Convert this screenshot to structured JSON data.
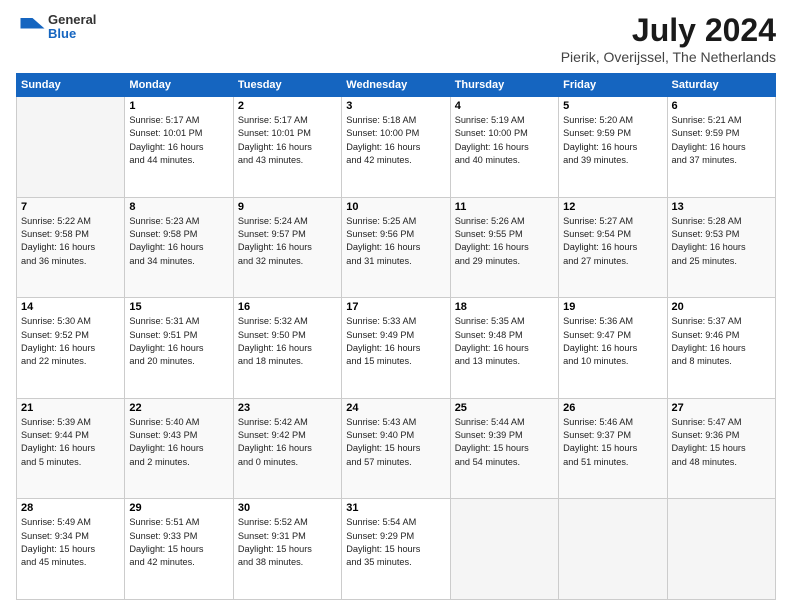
{
  "header": {
    "logo_general": "General",
    "logo_blue": "Blue",
    "month_year": "July 2024",
    "location": "Pierik, Overijssel, The Netherlands"
  },
  "weekdays": [
    "Sunday",
    "Monday",
    "Tuesday",
    "Wednesday",
    "Thursday",
    "Friday",
    "Saturday"
  ],
  "weeks": [
    [
      {
        "day": "",
        "info": ""
      },
      {
        "day": "1",
        "info": "Sunrise: 5:17 AM\nSunset: 10:01 PM\nDaylight: 16 hours\nand 44 minutes."
      },
      {
        "day": "2",
        "info": "Sunrise: 5:17 AM\nSunset: 10:01 PM\nDaylight: 16 hours\nand 43 minutes."
      },
      {
        "day": "3",
        "info": "Sunrise: 5:18 AM\nSunset: 10:00 PM\nDaylight: 16 hours\nand 42 minutes."
      },
      {
        "day": "4",
        "info": "Sunrise: 5:19 AM\nSunset: 10:00 PM\nDaylight: 16 hours\nand 40 minutes."
      },
      {
        "day": "5",
        "info": "Sunrise: 5:20 AM\nSunset: 9:59 PM\nDaylight: 16 hours\nand 39 minutes."
      },
      {
        "day": "6",
        "info": "Sunrise: 5:21 AM\nSunset: 9:59 PM\nDaylight: 16 hours\nand 37 minutes."
      }
    ],
    [
      {
        "day": "7",
        "info": "Sunrise: 5:22 AM\nSunset: 9:58 PM\nDaylight: 16 hours\nand 36 minutes."
      },
      {
        "day": "8",
        "info": "Sunrise: 5:23 AM\nSunset: 9:58 PM\nDaylight: 16 hours\nand 34 minutes."
      },
      {
        "day": "9",
        "info": "Sunrise: 5:24 AM\nSunset: 9:57 PM\nDaylight: 16 hours\nand 32 minutes."
      },
      {
        "day": "10",
        "info": "Sunrise: 5:25 AM\nSunset: 9:56 PM\nDaylight: 16 hours\nand 31 minutes."
      },
      {
        "day": "11",
        "info": "Sunrise: 5:26 AM\nSunset: 9:55 PM\nDaylight: 16 hours\nand 29 minutes."
      },
      {
        "day": "12",
        "info": "Sunrise: 5:27 AM\nSunset: 9:54 PM\nDaylight: 16 hours\nand 27 minutes."
      },
      {
        "day": "13",
        "info": "Sunrise: 5:28 AM\nSunset: 9:53 PM\nDaylight: 16 hours\nand 25 minutes."
      }
    ],
    [
      {
        "day": "14",
        "info": "Sunrise: 5:30 AM\nSunset: 9:52 PM\nDaylight: 16 hours\nand 22 minutes."
      },
      {
        "day": "15",
        "info": "Sunrise: 5:31 AM\nSunset: 9:51 PM\nDaylight: 16 hours\nand 20 minutes."
      },
      {
        "day": "16",
        "info": "Sunrise: 5:32 AM\nSunset: 9:50 PM\nDaylight: 16 hours\nand 18 minutes."
      },
      {
        "day": "17",
        "info": "Sunrise: 5:33 AM\nSunset: 9:49 PM\nDaylight: 16 hours\nand 15 minutes."
      },
      {
        "day": "18",
        "info": "Sunrise: 5:35 AM\nSunset: 9:48 PM\nDaylight: 16 hours\nand 13 minutes."
      },
      {
        "day": "19",
        "info": "Sunrise: 5:36 AM\nSunset: 9:47 PM\nDaylight: 16 hours\nand 10 minutes."
      },
      {
        "day": "20",
        "info": "Sunrise: 5:37 AM\nSunset: 9:46 PM\nDaylight: 16 hours\nand 8 minutes."
      }
    ],
    [
      {
        "day": "21",
        "info": "Sunrise: 5:39 AM\nSunset: 9:44 PM\nDaylight: 16 hours\nand 5 minutes."
      },
      {
        "day": "22",
        "info": "Sunrise: 5:40 AM\nSunset: 9:43 PM\nDaylight: 16 hours\nand 2 minutes."
      },
      {
        "day": "23",
        "info": "Sunrise: 5:42 AM\nSunset: 9:42 PM\nDaylight: 16 hours\nand 0 minutes."
      },
      {
        "day": "24",
        "info": "Sunrise: 5:43 AM\nSunset: 9:40 PM\nDaylight: 15 hours\nand 57 minutes."
      },
      {
        "day": "25",
        "info": "Sunrise: 5:44 AM\nSunset: 9:39 PM\nDaylight: 15 hours\nand 54 minutes."
      },
      {
        "day": "26",
        "info": "Sunrise: 5:46 AM\nSunset: 9:37 PM\nDaylight: 15 hours\nand 51 minutes."
      },
      {
        "day": "27",
        "info": "Sunrise: 5:47 AM\nSunset: 9:36 PM\nDaylight: 15 hours\nand 48 minutes."
      }
    ],
    [
      {
        "day": "28",
        "info": "Sunrise: 5:49 AM\nSunset: 9:34 PM\nDaylight: 15 hours\nand 45 minutes."
      },
      {
        "day": "29",
        "info": "Sunrise: 5:51 AM\nSunset: 9:33 PM\nDaylight: 15 hours\nand 42 minutes."
      },
      {
        "day": "30",
        "info": "Sunrise: 5:52 AM\nSunset: 9:31 PM\nDaylight: 15 hours\nand 38 minutes."
      },
      {
        "day": "31",
        "info": "Sunrise: 5:54 AM\nSunset: 9:29 PM\nDaylight: 15 hours\nand 35 minutes."
      },
      {
        "day": "",
        "info": ""
      },
      {
        "day": "",
        "info": ""
      },
      {
        "day": "",
        "info": ""
      }
    ]
  ]
}
